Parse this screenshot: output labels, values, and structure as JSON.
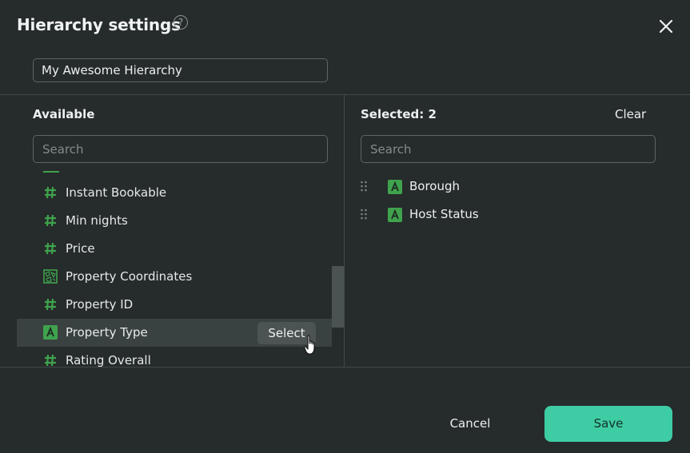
{
  "dialog": {
    "title": "Hierarchy settings",
    "help_glyph": "?",
    "close_icon": "close-icon",
    "name_value": "My Awesome Hierarchy"
  },
  "available": {
    "label": "Available",
    "search_placeholder": "Search",
    "items": [
      {
        "label": "Instant Bookable",
        "icon": "number-icon"
      },
      {
        "label": "Min nights",
        "icon": "number-icon"
      },
      {
        "label": "Price",
        "icon": "number-icon"
      },
      {
        "label": "Property Coordinates",
        "icon": "geo-icon"
      },
      {
        "label": "Property ID",
        "icon": "number-icon"
      },
      {
        "label": "Property Type",
        "icon": "text-attribute-icon"
      },
      {
        "label": "Rating Overall",
        "icon": "number-icon"
      }
    ],
    "hover_select_label": "Select"
  },
  "selected": {
    "label": "Selected: 2",
    "clear_label": "Clear",
    "search_placeholder": "Search",
    "items": [
      {
        "label": "Borough",
        "icon": "text-attribute-icon"
      },
      {
        "label": "Host Status",
        "icon": "text-attribute-icon"
      }
    ]
  },
  "footer": {
    "cancel_label": "Cancel",
    "save_label": "Save"
  },
  "colors": {
    "background": "#262b2b",
    "accent_save": "#3ecca4",
    "icon_green": "#3fa34d"
  }
}
